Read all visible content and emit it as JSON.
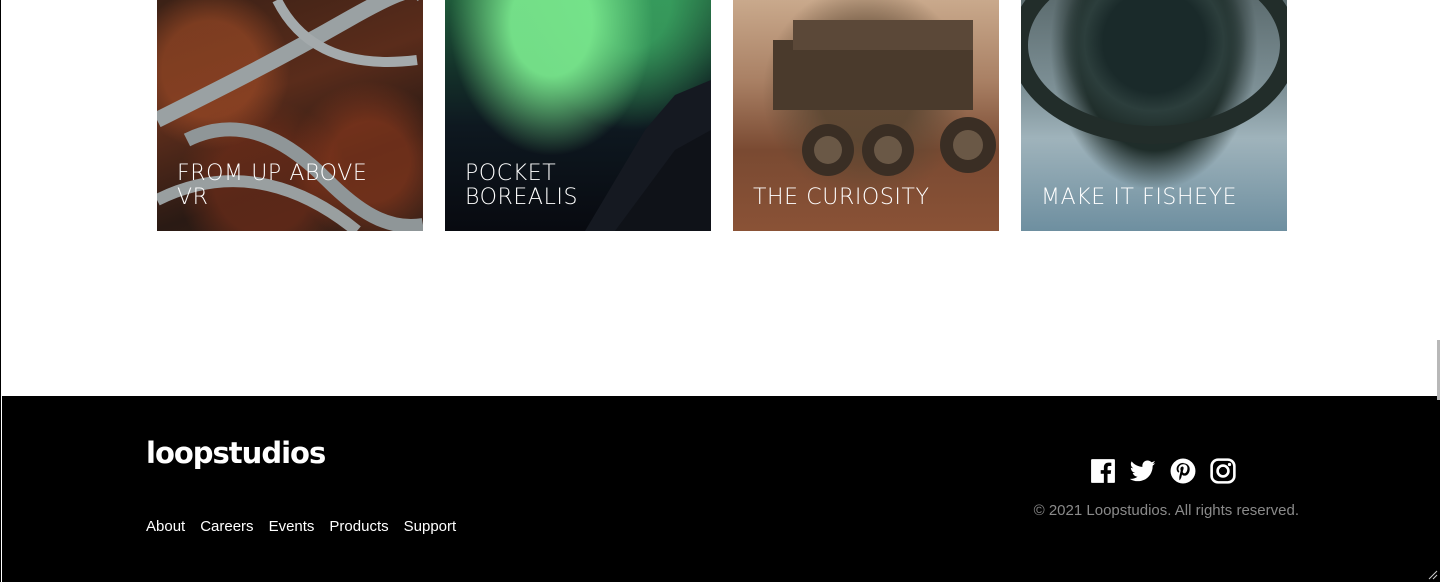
{
  "creations": [
    {
      "title": "From Up Above VR",
      "image": "aerial-roads-image"
    },
    {
      "title": "Pocket Borealis",
      "image": "aurora-image"
    },
    {
      "title": "The Curiosity",
      "image": "rover-image"
    },
    {
      "title": "Make It Fisheye",
      "image": "fisheye-image"
    }
  ],
  "footer": {
    "logo": "loopstudios",
    "nav": [
      "About",
      "Careers",
      "Events",
      "Products",
      "Support"
    ],
    "social_icons": [
      "facebook-icon",
      "twitter-icon",
      "pinterest-icon",
      "instagram-icon"
    ],
    "copyright": "© 2021 Loopstudios. All rights reserved."
  },
  "colors": {
    "footer_bg": "#000000",
    "text_light": "#ffffff",
    "copyright_text": "#8a8a8a"
  }
}
